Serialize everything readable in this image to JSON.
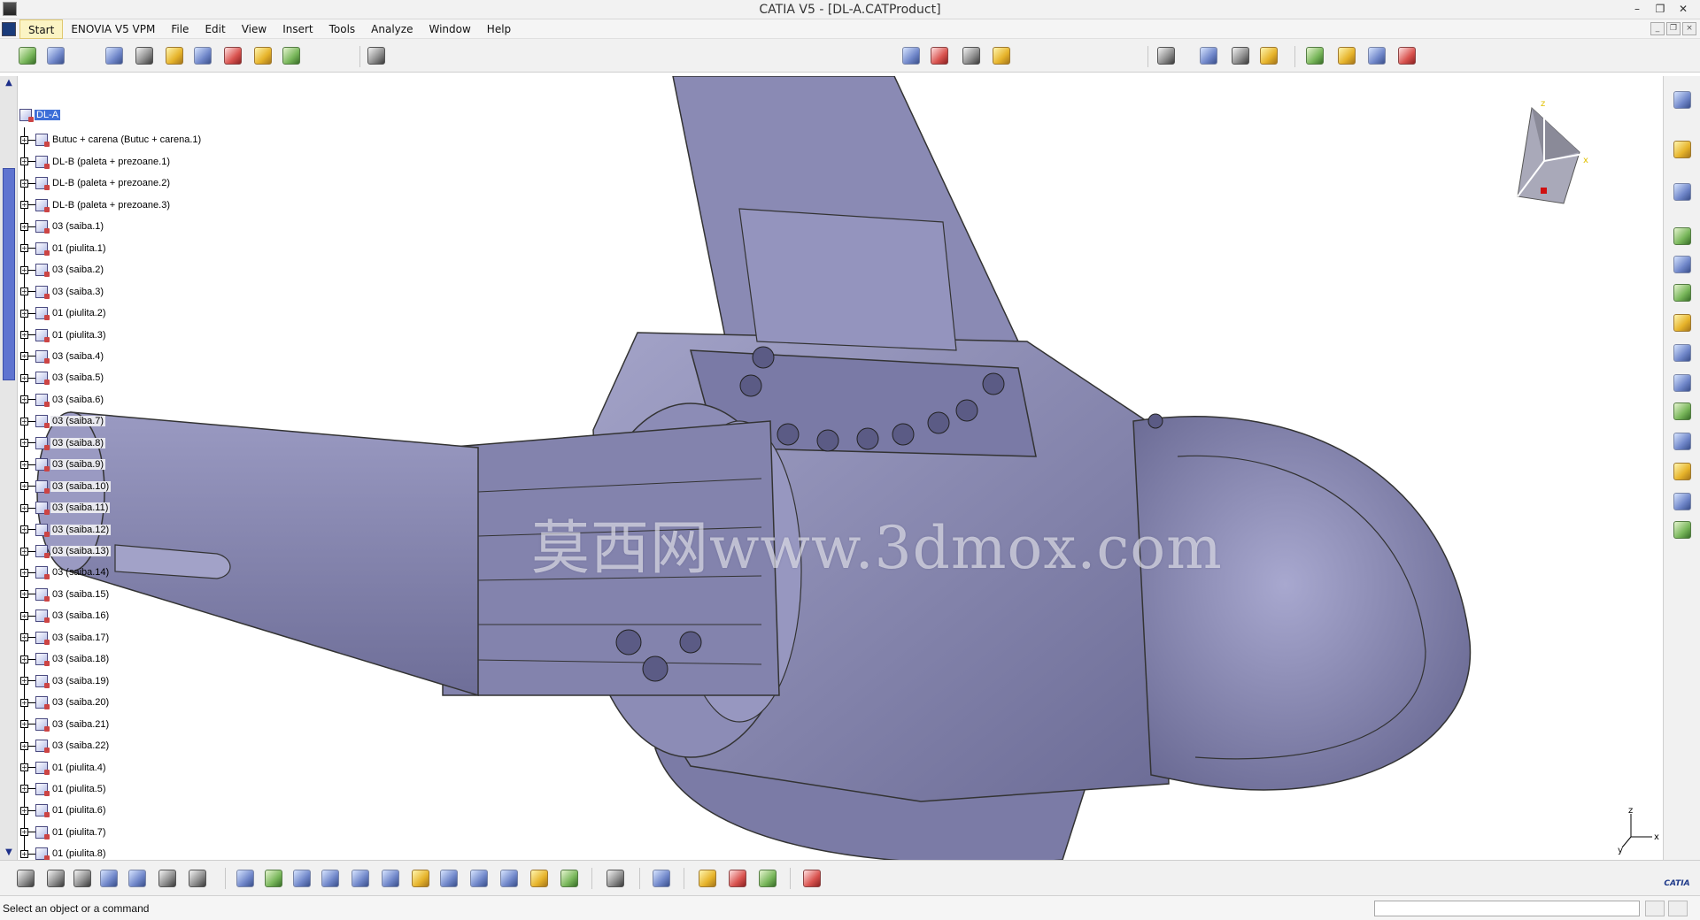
{
  "window": {
    "title": "CATIA V5 - [DL-A.CATProduct]",
    "controls": [
      "–",
      "❐",
      "✕"
    ],
    "mdi_controls": [
      "_",
      "❐",
      "×"
    ]
  },
  "menu": {
    "items": [
      "Start",
      "ENOVIA V5 VPM",
      "File",
      "Edit",
      "View",
      "Insert",
      "Tools",
      "Analyze",
      "Window",
      "Help"
    ],
    "active_index": 0
  },
  "tree": {
    "root": "DL-A",
    "nodes": [
      "Butuc + carena (Butuc + carena.1)",
      "DL-B (paleta + prezoane.1)",
      "DL-B (paleta + prezoane.2)",
      "DL-B (paleta + prezoane.3)",
      "03 (saiba.1)",
      "01 (piulita.1)",
      "03 (saiba.2)",
      "03 (saiba.3)",
      "01 (piulita.2)",
      "01 (piulita.3)",
      "03 (saiba.4)",
      "03 (saiba.5)",
      "03 (saiba.6)",
      "03 (saiba.7)",
      "03 (saiba.8)",
      "03 (saiba.9)",
      "03 (saiba.10)",
      "03 (saiba.11)",
      "03 (saiba.12)",
      "03 (saiba.13)",
      "03 (saiba.14)",
      "03 (saiba.15)",
      "03 (saiba.16)",
      "03 (saiba.17)",
      "03 (saiba.18)",
      "03 (saiba.19)",
      "03 (saiba.20)",
      "03 (saiba.21)",
      "03 (saiba.22)",
      "01 (piulita.4)",
      "01 (piulita.5)",
      "01 (piulita.6)",
      "01 (piulita.7)",
      "01 (piulita.8)"
    ]
  },
  "compass": {
    "x_label": "x",
    "y_label": "y",
    "z_label": "z"
  },
  "axis": {
    "x_label": "x",
    "y_label": "y",
    "z_label": "z"
  },
  "watermark": "莫西网www.3dmox.com",
  "status": {
    "message": "Select an object or a command"
  },
  "brand": {
    "logo_text": "CATIA"
  },
  "colors": {
    "model": "#8b8bb5",
    "tree_highlight": "#3e6fd8",
    "scroll_thumb": "#5f74d0"
  }
}
